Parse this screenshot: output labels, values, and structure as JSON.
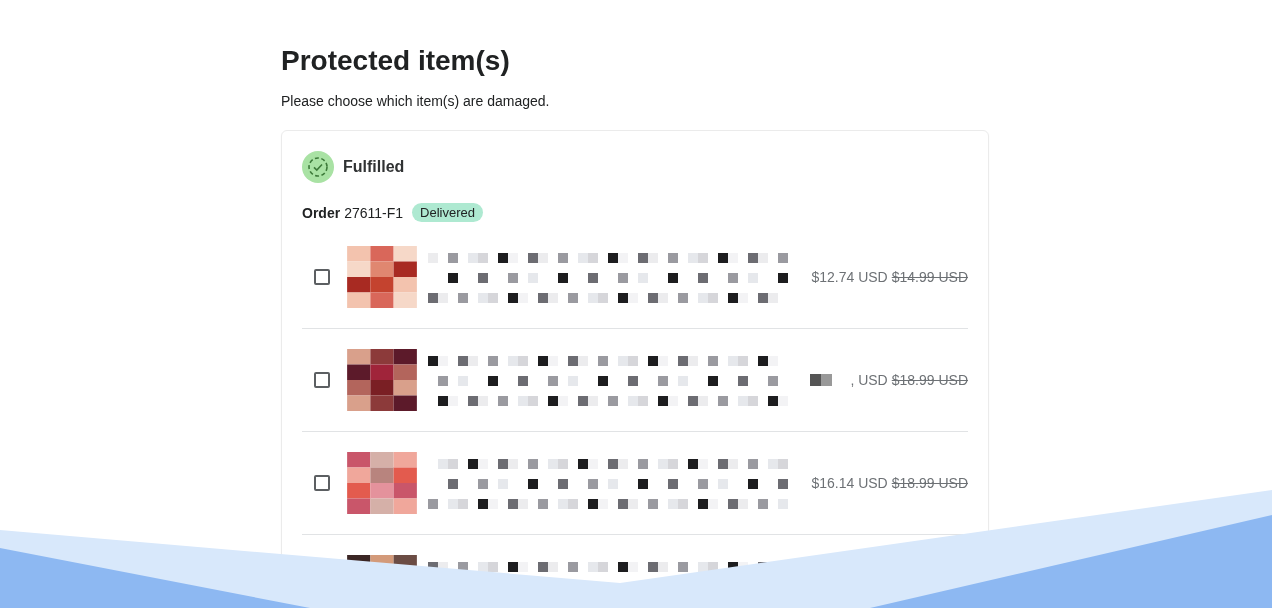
{
  "heading": "Protected item(s)",
  "subheading": "Please choose which item(s) are damaged.",
  "fulfillment": {
    "status": "Fulfilled",
    "order_label": "Order",
    "order_number": "27611-F1",
    "badge": "Delivered"
  },
  "items": [
    {
      "checked": false,
      "price": "$12.74 USD",
      "original_price": "$14.99 USD",
      "price_redacted": false
    },
    {
      "checked": false,
      "price": ", USD",
      "original_price": "$18.99 USD",
      "price_redacted": true
    },
    {
      "checked": false,
      "price": "$16.14 USD",
      "original_price": "$18.99 USD",
      "price_redacted": false
    }
  ]
}
